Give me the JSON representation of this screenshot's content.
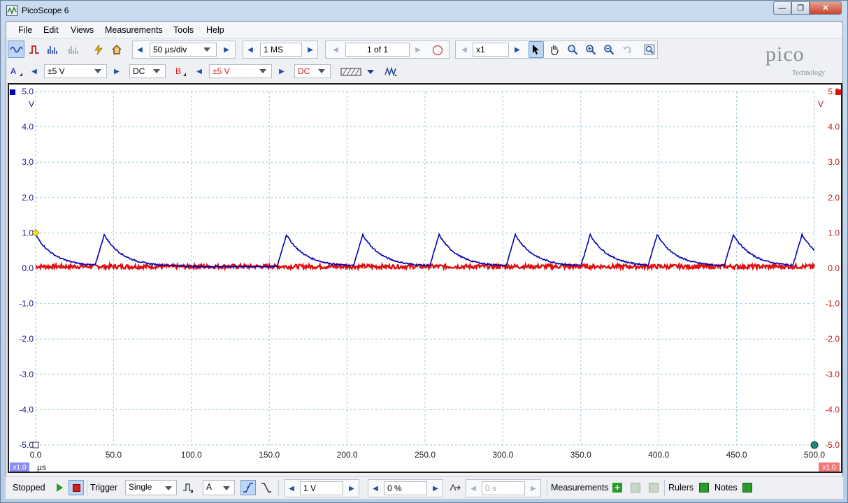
{
  "window": {
    "title": "PicoScope 6",
    "minimize_glyph": "—",
    "maximize_glyph": "❐",
    "close_glyph": "✕"
  },
  "menu": {
    "file": "File",
    "edit": "Edit",
    "views": "Views",
    "measurements": "Measurements",
    "tools": "Tools",
    "help": "Help"
  },
  "toolbar": {
    "timebase": "50 µs/div",
    "samples": "1 MS",
    "buffer_page": "1 of 1",
    "zoom": "x1"
  },
  "channels": {
    "a": {
      "label": "A",
      "range": "±5 V",
      "coupling": "DC",
      "color": "#0000b0"
    },
    "b": {
      "label": "B",
      "range": "±5 V",
      "coupling": "DC",
      "color": "#e01010"
    }
  },
  "logo": {
    "word": "pico",
    "sub": "Technology"
  },
  "chart_data": {
    "type": "line",
    "xlabel": "µs",
    "ylabel_left": "V",
    "ylabel_right": "V",
    "xlim": [
      0,
      500
    ],
    "ylim": [
      -5,
      5
    ],
    "x_ticks": [
      "0.0",
      "50.0",
      "100.0",
      "150.0",
      "200.0",
      "250.0",
      "300.0",
      "350.0",
      "400.0",
      "450.0",
      "500.0"
    ],
    "y_ticks": [
      "5.0",
      "4.0",
      "3.0",
      "2.0",
      "1.0",
      "0.0",
      "-1.0",
      "-2.0",
      "-3.0",
      "-4.0",
      "-5.0"
    ],
    "grid": true,
    "scale_badge_left": "x1.0",
    "scale_badge_right": "x1.0",
    "series": [
      {
        "name": "A",
        "color": "#0000b0",
        "pulse_peaks_us": [
          0,
          44,
          161,
          210,
          259,
          308,
          356,
          399,
          448,
          492
        ],
        "pulse_peak_v": 0.95,
        "baseline_v": 0.05
      },
      {
        "name": "B",
        "color": "#e01010",
        "baseline_v": 0.05,
        "noise_v": 0.06
      }
    ]
  },
  "status": {
    "state": "Stopped",
    "trigger_label": "Trigger",
    "trigger_mode": "Single",
    "trigger_channel": "A",
    "trigger_level": "1 V",
    "pretrigger": "0 %",
    "delay": "0 s",
    "measurements": "Measurements",
    "rulers": "Rulers",
    "notes": "Notes"
  }
}
